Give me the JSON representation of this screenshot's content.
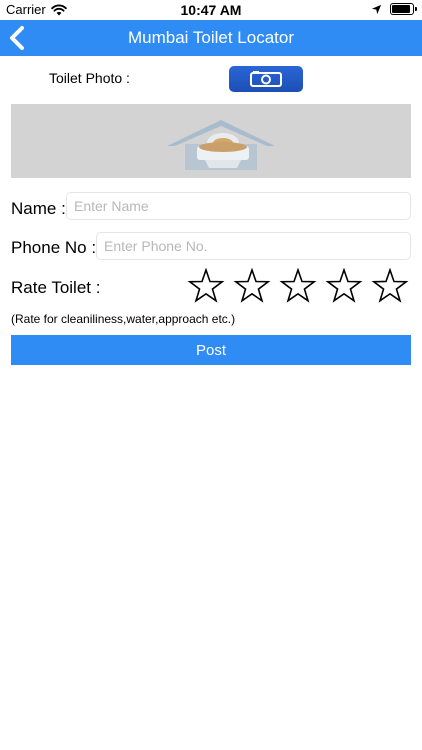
{
  "status_bar": {
    "carrier": "Carrier",
    "time": "10:47 AM",
    "battery_level": 1.0
  },
  "nav": {
    "title": "Mumbai Toilet Locator",
    "back_icon": "chevron-left-icon"
  },
  "photo": {
    "label": "Toilet Photo :",
    "camera_icon": "camera-icon",
    "preview_icon": "toilet-image"
  },
  "form": {
    "name_label": "Name :",
    "name_value": "",
    "name_placeholder": "Enter Name",
    "phone_label": "Phone No :",
    "phone_value": "",
    "phone_placeholder": "Enter Phone No.",
    "rate_label": "Rate Toilet :",
    "rating": 0,
    "rating_max": 5,
    "rate_hint": "(Rate for cleaniliness,water,approach etc.)",
    "post_label": "Post"
  },
  "colors": {
    "nav_background": "#2f8cf4",
    "post_background": "#2f8cf4",
    "camera_button": "#2a66d6",
    "preview_background": "#d3d3d3"
  }
}
